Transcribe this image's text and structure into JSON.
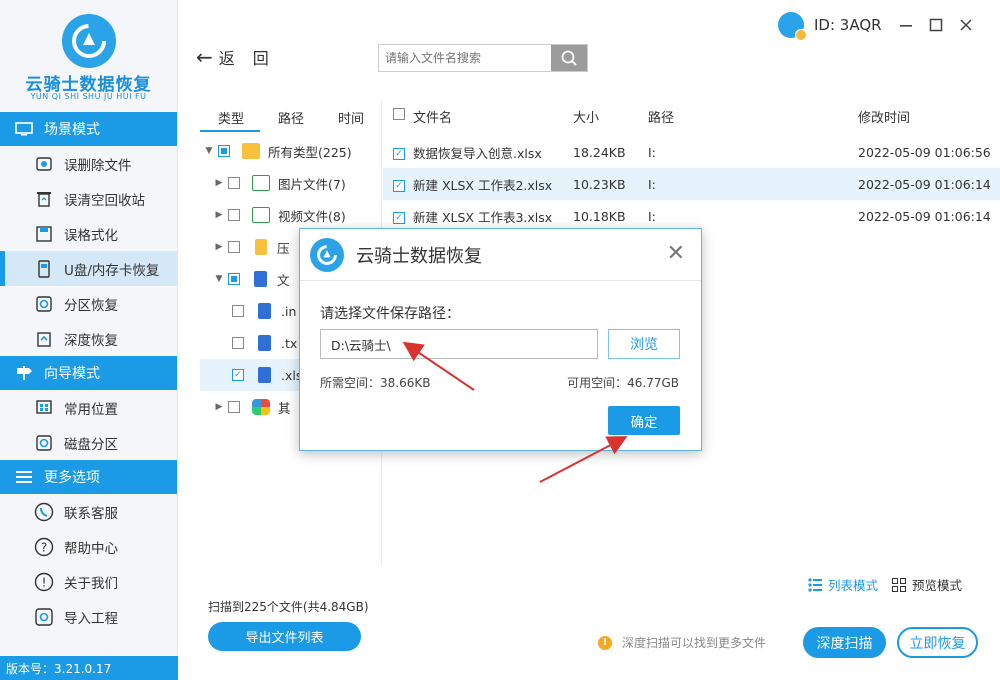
{
  "app": {
    "name": "云骑士数据恢复",
    "pinyin": "YUN QI SHI SHU JU HUI FU",
    "version": "版本号：3.21.0.17"
  },
  "topbar": {
    "user_id": "ID: 3AQR",
    "back_label": "返",
    "forward_label": "回",
    "search_placeholder": "请输入文件名搜索"
  },
  "sidebar": {
    "groups": [
      {
        "title": "场景模式",
        "items": [
          "误删除文件",
          "误清空回收站",
          "误格式化",
          "U盘/内存卡恢复",
          "分区恢复",
          "深度恢复"
        ]
      },
      {
        "title": "向导模式",
        "items": [
          "常用位置",
          "磁盘分区"
        ]
      },
      {
        "title": "更多选项",
        "items": [
          "联系客服",
          "帮助中心",
          "关于我们",
          "导入工程"
        ]
      }
    ]
  },
  "tree": {
    "tabs": [
      "类型",
      "路径",
      "时间"
    ],
    "rows": [
      {
        "label": "所有类型(225)"
      },
      {
        "label": "图片文件(7)"
      },
      {
        "label": "视频文件(8)"
      },
      {
        "label": "压"
      },
      {
        "label": "文"
      },
      {
        "label": ".in"
      },
      {
        "label": ".tx"
      },
      {
        "label": ".xls"
      },
      {
        "label": "其"
      }
    ]
  },
  "table": {
    "headers": {
      "name": "文件名",
      "size": "大小",
      "path": "路径",
      "time": "修改时间"
    },
    "rows": [
      {
        "name": "数据恢复导入创意.xlsx",
        "size": "18.24KB",
        "path": "I:",
        "time": "2022-05-09 01:06:56"
      },
      {
        "name": "新建 XLSX 工作表2.xlsx",
        "size": "10.23KB",
        "path": "I:",
        "time": "2022-05-09 01:06:14"
      },
      {
        "name": "新建 XLSX 工作表3.xlsx",
        "size": "10.18KB",
        "path": "I:",
        "time": "2022-05-09 01:06:14"
      }
    ]
  },
  "bottom": {
    "scan_info": "扫描到225个文件(共4.84GB)",
    "export_label": "导出文件列表",
    "list_mode": "列表模式",
    "preview_mode": "预览模式",
    "hint": "深度扫描可以找到更多文件",
    "deep_scan": "深度扫描",
    "recover_now": "立即恢复"
  },
  "dialog": {
    "title": "云骑士数据恢复",
    "label": "请选择文件保存路径：",
    "path_value": "D:\\云骑士\\",
    "browse_label": "浏览",
    "required_space": "所需空间：38.66KB",
    "available_space": "可用空间：46.77GB",
    "ok_label": "确定"
  },
  "colors": {
    "accent": "#1b9be6",
    "arrow": "#d9322f",
    "warning": "#f5a623"
  }
}
